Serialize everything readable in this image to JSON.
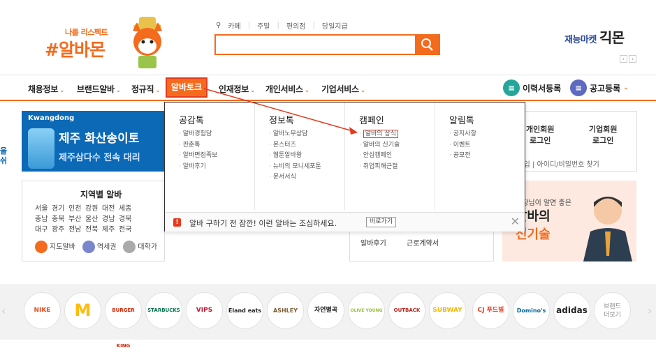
{
  "logo": {
    "slogan": "나를 리스펙트",
    "name": "#알바몬"
  },
  "search": {
    "quick_links": [
      "카페",
      "주말",
      "편의점",
      "당일지급"
    ],
    "placeholder": ""
  },
  "talent_market": {
    "prefix": "재능마켓",
    "name": "긱몬"
  },
  "nav": {
    "items": [
      "채용정보",
      "브랜드알바",
      "정규직",
      "알바토크",
      "인재정보",
      "개인서비스",
      "기업서비스"
    ],
    "active": "알바토크",
    "resume": "이력서등록",
    "post": "공고등록"
  },
  "dropdown": {
    "columns": [
      {
        "title": "공감톡",
        "items": [
          "알바경험담",
          "판춘톡",
          "알바면접족보",
          "알바후기"
        ]
      },
      {
        "title": "정보톡",
        "items": [
          "알바노무상담",
          "몬스터즈",
          "웹툰알바왕",
          "뉴비의 모니세포툰",
          "문서서식"
        ]
      },
      {
        "title": "캠페인",
        "items": [
          "알바의 상식",
          "알바의 신기술",
          "안심캠페인",
          "취업피해근절"
        ]
      },
      {
        "title": "알림톡",
        "items": [
          "공지사항",
          "이벤트",
          "공모전"
        ]
      }
    ],
    "highlighted": "알바의 상식",
    "notice": "알바 구하기 전 잠깐! 이런 알바는 조심하세요.",
    "notice_button": "바로가기"
  },
  "banner": {
    "brand": "Kwangdong",
    "line1": "제주 화산송이토",
    "line2": "제주삼다수 전속 대리"
  },
  "region": {
    "title": "지역별 알바",
    "rows": [
      [
        "서울",
        "경기",
        "인천",
        "강원",
        "대전",
        "세종"
      ],
      [
        "충남",
        "충북",
        "부산",
        "울산",
        "경남",
        "경북"
      ],
      [
        "대구",
        "광주",
        "전남",
        "전북",
        "제주",
        "전국"
      ]
    ],
    "links": [
      "지도알바",
      "역세권",
      "대학가"
    ]
  },
  "login": {
    "personal": "개인회원\n로그인",
    "company": "기업회원\n로그인",
    "links": "회원가입 | 아이디/비밀번호 찾기"
  },
  "center": {
    "items": [
      "알바후기",
      "근로계약서"
    ]
  },
  "ad": {
    "line1": "사장님이 알면 좋은",
    "line2": "알바의",
    "line3": "신기술"
  },
  "left_peek": [
    "울",
    "쉬"
  ],
  "brands": [
    "NIKE",
    "M",
    "BURGER KING",
    "STARBUCKS",
    "VIPS",
    "Eland eats",
    "ASHLEY",
    "자연별곡",
    "OLIVE YOUNG",
    "OUTBACK",
    "SUBWAY",
    "CJ 푸드빌",
    "Domino's",
    "adidas",
    "브랜드\n더보기"
  ],
  "colors": {
    "accent": "#f46b1d",
    "highlight": "#e53a1e",
    "banner": "#0b69b6"
  }
}
